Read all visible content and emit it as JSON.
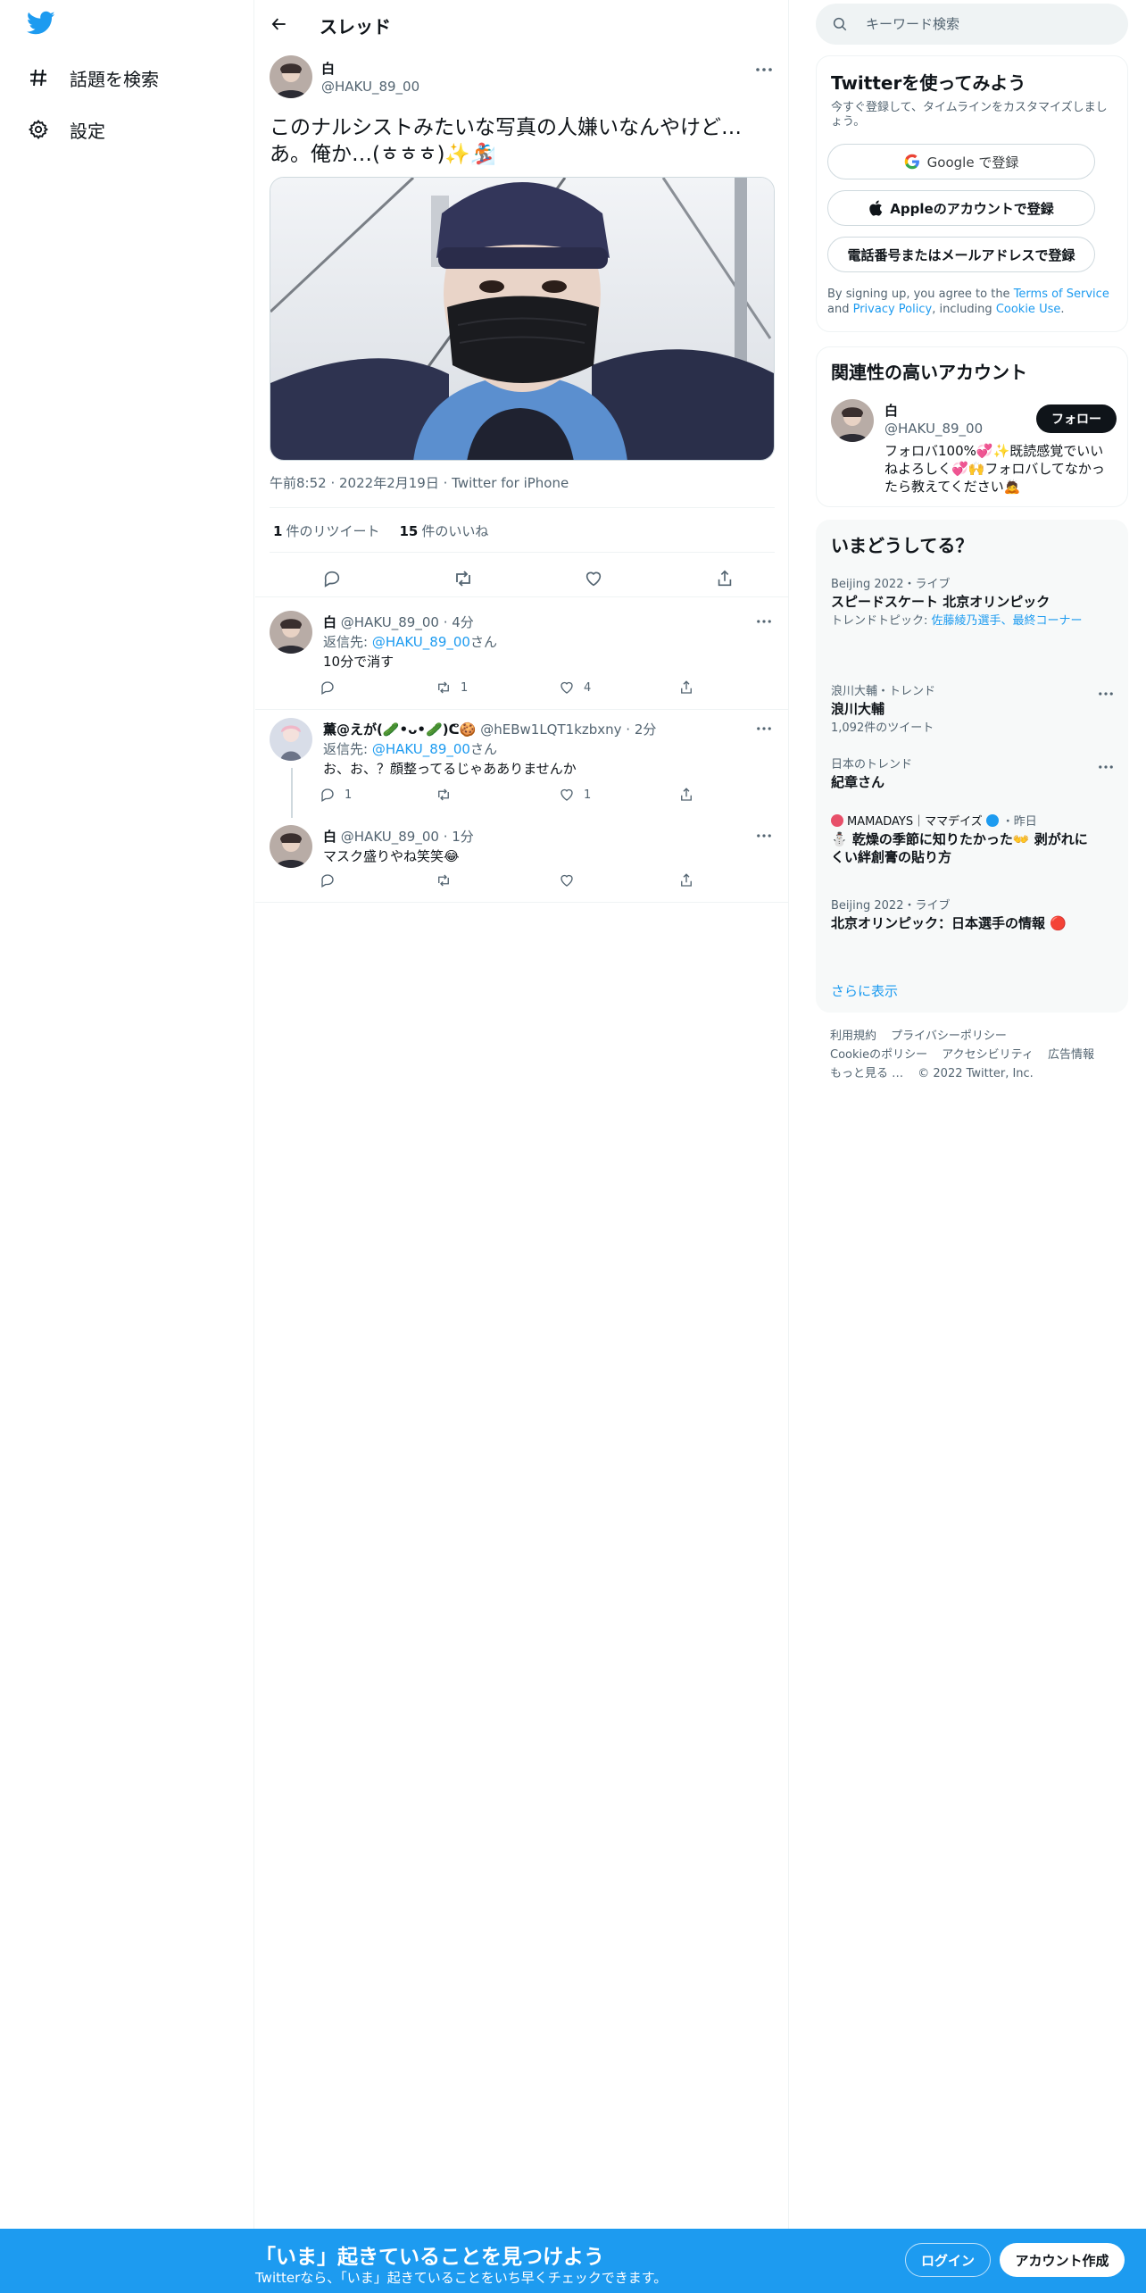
{
  "nav": {
    "explore_label": "話題を検索",
    "settings_label": "設定"
  },
  "header": {
    "title": "スレッド"
  },
  "tweet": {
    "name": "白",
    "handle": "@HAKU_89_00",
    "text": "このナルシストみたいな写真の人嫌いなんやけど…あ。俺か…(ㅎㅎㅎ)✨🏂",
    "time": "午前8:52",
    "date": "2022年2月19日",
    "source": "Twitter for iPhone",
    "retweets_count": "1",
    "retweets_label": "件のリツイート",
    "likes_count": "15",
    "likes_label": "件のいいね"
  },
  "replies": [
    {
      "name": "白",
      "meta": "@HAKU_89_00 · 4分",
      "replying_prefix": "返信先: ",
      "mention": "@HAKU_89_00",
      "replying_suffix": "さん",
      "text": "10分で消す",
      "retweets": "1",
      "likes": "4"
    },
    {
      "name": "薫@えが(🥒•ᴗ•🥒)ᕦ🍪",
      "meta": "@hEBw1LQT1kzbxny · 2分",
      "replying_prefix": "返信先: ",
      "mention": "@HAKU_89_00",
      "replying_suffix": "さん",
      "text": "お、お、？顔整ってるじゃあありませんか",
      "replies_count": "1",
      "likes": "1"
    },
    {
      "name": "白",
      "meta": "@HAKU_89_00 · 1分",
      "text": "マスク盛りやね笑笑😂"
    }
  ],
  "search": {
    "placeholder": "キーワード検索"
  },
  "signup": {
    "title": "Twitterを使ってみよう",
    "subtitle": "今すぐ登録して、タイムラインをカスタマイズしましょう。",
    "google_label": "Google で登録",
    "apple_label": "Appleのアカウントで登録",
    "phone_label": "電話番号またはメールアドレスで登録",
    "terms_prefix": "By signing up, you agree to the ",
    "terms_link": "Terms of Service",
    "terms_and": " and ",
    "privacy_link": "Privacy Policy",
    "terms_including": ", including ",
    "cookie_link": "Cookie Use",
    "terms_end": "."
  },
  "related": {
    "title": "関連性の高いアカウント",
    "name": "白",
    "handle": "@HAKU_89_00",
    "follow_label": "フォロー",
    "bio": "フォロバ100%💞✨既読感覚でいいねよろしく💞🙌フォロバしてなかったら教えてください🙇"
  },
  "trends": {
    "title": "いまどうしてる？",
    "items": [
      {
        "meta": "Beijing 2022・ライブ",
        "title": "スピードスケート 北京オリンピック",
        "sub_prefix": "トレンドトピック: ",
        "sub_links": "佐藤綾乃選手、最終コーナー"
      },
      {
        "meta": "浪川大輔・トレンド",
        "title": "浪川大輔",
        "sub": "1,092件のツイート"
      },
      {
        "meta": "日本のトレンド",
        "title": "紀章さん"
      },
      {
        "meta_name": "MAMADAYS｜ママデイズ",
        "meta_time": "・昨日",
        "title": "⛄ 乾燥の季節に知りたかった👐 剥がれにくい絆創膏の貼り方"
      },
      {
        "meta": "Beijing 2022・ライブ",
        "title": "北京オリンピック：日本選手の情報 🔴"
      }
    ],
    "show_more": "さらに表示"
  },
  "footer": {
    "terms": "利用規約",
    "privacy": "プライバシーポリシー",
    "cookies": "Cookieのポリシー",
    "accessibility": "アクセシビリティ",
    "ads": "広告情報",
    "more": "もっと見る …",
    "copyright": "© 2022 Twitter, Inc."
  },
  "bottombar": {
    "title": "「いま」起きていることを見つけよう",
    "subtitle": "Twitterなら、「いま」起きていることをいち早くチェックできます。",
    "login_label": "ログイン",
    "signup_label": "アカウント作成"
  },
  "colors": {
    "accent": "#1d9bf0",
    "text": "#0f1419",
    "secondary": "#536471",
    "border": "#eff3f4"
  }
}
